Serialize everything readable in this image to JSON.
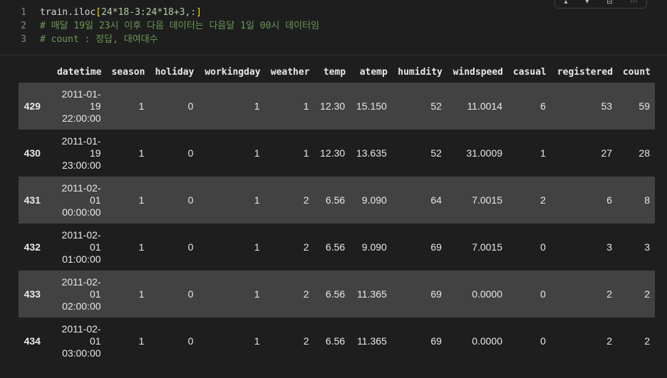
{
  "cell": {
    "lines": [
      {
        "num": "1",
        "parts": [
          {
            "text": "train.iloc",
            "cls": "code-fn"
          },
          {
            "text": "[",
            "cls": "code-br"
          },
          {
            "text": "24*18-3:24*18+3,:",
            "cls": "code-num"
          },
          {
            "text": "]",
            "cls": "code-br"
          }
        ]
      },
      {
        "num": "2",
        "parts": [
          {
            "text": "# 매달 19일 23시 이후 다음 데이터는 다음달 1일 00시 데이터임",
            "cls": "code-comment"
          }
        ]
      },
      {
        "num": "3",
        "parts": [
          {
            "text": "# count : 정답, 대여대수",
            "cls": "code-comment"
          }
        ]
      }
    ]
  },
  "table": {
    "columns": [
      "",
      "datetime",
      "season",
      "holiday",
      "workingday",
      "weather",
      "temp",
      "atemp",
      "humidity",
      "windspeed",
      "casual",
      "registered",
      "count"
    ],
    "rows": [
      {
        "index": "429",
        "datetime": [
          "2011-01-",
          "19",
          "22:00:00"
        ],
        "values": [
          "1",
          "0",
          "1",
          "1",
          "12.30",
          "15.150",
          "52",
          "11.0014",
          "6",
          "53",
          "59"
        ]
      },
      {
        "index": "430",
        "datetime": [
          "2011-01-",
          "19",
          "23:00:00"
        ],
        "values": [
          "1",
          "0",
          "1",
          "1",
          "12.30",
          "13.635",
          "52",
          "31.0009",
          "1",
          "27",
          "28"
        ]
      },
      {
        "index": "431",
        "datetime": [
          "2011-02-",
          "01",
          "00:00:00"
        ],
        "values": [
          "1",
          "0",
          "1",
          "2",
          "6.56",
          "9.090",
          "64",
          "7.0015",
          "2",
          "6",
          "8"
        ]
      },
      {
        "index": "432",
        "datetime": [
          "2011-02-",
          "01",
          "01:00:00"
        ],
        "values": [
          "1",
          "0",
          "1",
          "2",
          "6.56",
          "9.090",
          "69",
          "7.0015",
          "0",
          "3",
          "3"
        ]
      },
      {
        "index": "433",
        "datetime": [
          "2011-02-",
          "01",
          "02:00:00"
        ],
        "values": [
          "1",
          "0",
          "1",
          "2",
          "6.56",
          "11.365",
          "69",
          "0.0000",
          "0",
          "2",
          "2"
        ]
      },
      {
        "index": "434",
        "datetime": [
          "2011-02-",
          "01",
          "03:00:00"
        ],
        "values": [
          "1",
          "0",
          "1",
          "2",
          "6.56",
          "11.365",
          "69",
          "0.0000",
          "0",
          "2",
          "2"
        ]
      }
    ]
  }
}
